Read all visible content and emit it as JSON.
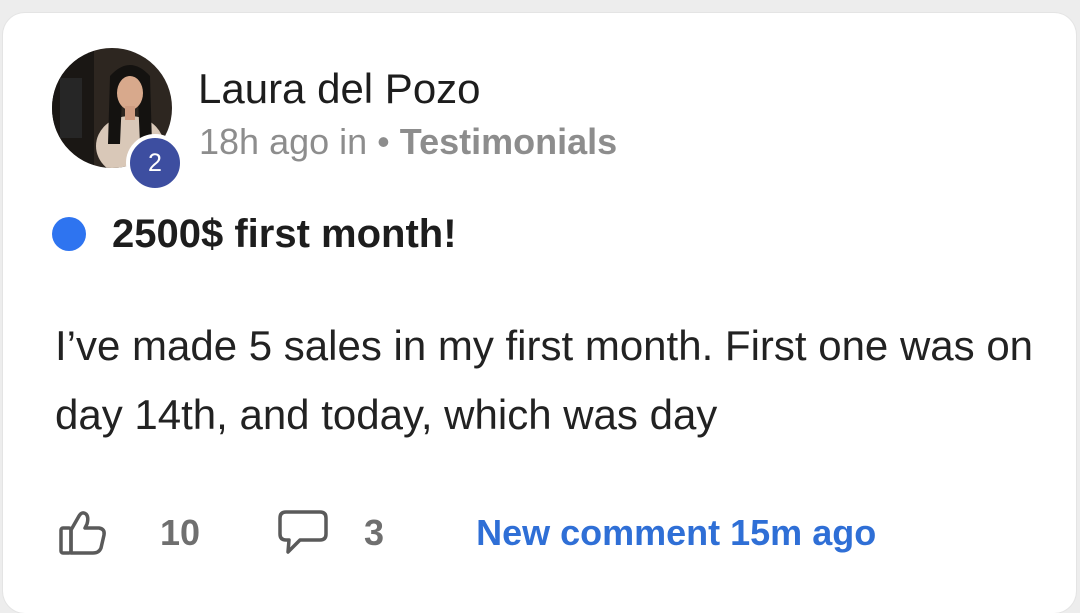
{
  "post": {
    "author": {
      "name": "Laura del Pozo",
      "level": "2",
      "time_ago": "18h ago in",
      "separator": "•",
      "category": "Testimonials"
    },
    "title": "2500$ first month!",
    "body": "I’ve made 5 sales in my first month. First one was on day 14th, and today, which was day",
    "stats": {
      "likes": "10",
      "comments": "3",
      "new_comment": "New comment 15m ago"
    }
  },
  "colors": {
    "unread_dot": "#2e74f0",
    "level_badge": "#3d4ea0",
    "link": "#2f6fd6"
  },
  "icons": {
    "like": "thumbs-up-icon",
    "comment": "comment-bubble-icon",
    "unread": "unread-dot-icon"
  }
}
